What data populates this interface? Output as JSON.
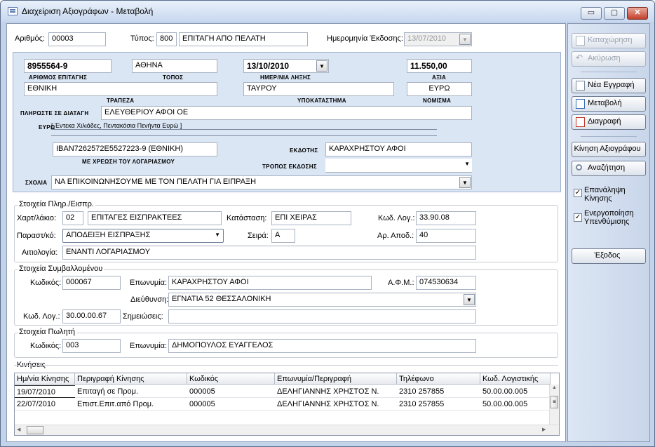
{
  "window": {
    "title": "Διαχείριση Αξιογράφων - Μεταβολή",
    "min": "▭",
    "max": "▢",
    "close": "✕"
  },
  "header": {
    "arithmos_label": "Αριθμός:",
    "arithmos": "00003",
    "typos_label": "Τύπος:",
    "typos_code": "800",
    "typos_desc": "ΕΠΙΤΑΓΗ ΑΠΟ ΠΕΛΑΤΗ",
    "hmer_label": "Ημερομηνία Έκδοσης:",
    "hmer_value": "13/07/2010"
  },
  "cheque": {
    "number": "8955564-9",
    "number_lbl": "ΑΡΙΘΜΟΣ ΕΠΙΤΑΓΗΣ",
    "place": "ΑΘΗΝΑ",
    "place_lbl": "ΤΟΠΟΣ",
    "due": "13/10/2010",
    "due_lbl": "ΗΜΕΡ/ΝΙΑ ΛΗΞΗΣ",
    "amount": "11.550,00",
    "amount_lbl": "ΑΞΙΑ",
    "bank": "ΕΘΝΙΚΗ",
    "bank_lbl": "ΤΡΑΠΕΖΑ",
    "branch": "ΤΑΥΡΟΥ",
    "branch_lbl": "ΥΠΟΚΑΤΑΣΤΗΜΑ",
    "currency": "ΕΥΡΩ",
    "currency_lbl": "ΝΟΜΙΣΜΑ",
    "payto_lbl": "ΠΛΗΡΩΣΤΕ ΣΕ ΔΙΑΤΑΓΗ",
    "payto": "ΕΛΕΥΘΕΡΙΟΥ ΑΦΟΙ ΟΕ",
    "euro_lbl": "ΕΥΡΩ",
    "amount_words": "[ Έντεκα Χιλιάδες, Πεντακόσια Πενήντα Ευρώ ]",
    "iban": "IBAN7262572E5527223-9 (ΕΘΝΙΚΗ)",
    "iban_lbl": "ΜΕ ΧΡΕΩΣΗ ΤΟΥ ΛΟΓΑΡΙΑΣΜΟΥ",
    "issuer_lbl": "ΕΚΔΟΤΗΣ",
    "issuer": "ΚΑΡΑΧΡΗΣΤΟΥ ΑΦΟΙ",
    "method_lbl": "ΤΡΟΠΟΣ ΕΚΔΟΣΗΣ",
    "method": "",
    "notes_lbl": "ΣΧΟΛΙΑ",
    "notes": "ΝΑ ΕΠΙΚΟΙΝΩΝΗΣΟΥΜΕ ΜΕ ΤΟΝ ΠΕΛΑΤΗ ΓΙΑ ΕΙΠΡΑΞΗ"
  },
  "payment": {
    "title": "Στοιχεία Πληρ./Εισπρ.",
    "xart_lbl": "Χαρτ/λάκιο:",
    "xart_code": "02",
    "xart_desc": "ΕΠΙΤΑΓΕΣ ΕΙΣΠΡΑΚΤΕΕΣ",
    "status_lbl": "Κατάσταση:",
    "status": "ΕΠΙ ΧΕΙΡΑΣ",
    "kodlog_lbl": "Κωδ. Λογ.:",
    "kodlog": "33.90.08",
    "parast_lbl": "Παραστ/κό:",
    "parast": "ΑΠΟΔΕΙΞΗ ΕΙΣΠΡΑΞΗΣ",
    "seira_lbl": "Σειρά:",
    "seira": "Α",
    "arapod_lbl": "Αρ. Αποδ.:",
    "arapod": "40",
    "aitiol_lbl": "Αιτιολογία:",
    "aitiol": "ΕΝΑΝΤΙ ΛΟΓΑΡΙΑΣΜΟΥ"
  },
  "party": {
    "title": "Στοιχεία Συμβαλλομένου",
    "kod_lbl": "Κωδικός:",
    "kod": "000067",
    "eponymia_lbl": "Επωνυμία:",
    "eponymia": "ΚΑΡΑΧΡΗΣΤΟΥ ΑΦΟΙ",
    "afm_lbl": "Α.Φ.Μ.:",
    "afm": "074530634",
    "addr_lbl": "Διεύθυνση:",
    "addr": "ΕΓΝΑΤΙΑ 52 ΘΕΣΣΑΛΟΝΙΚΗ",
    "kodlog_lbl": "Κωδ. Λογ.:",
    "kodlog": "30.00.00.67",
    "notes_lbl": "Σημειώσεις:",
    "notes": ""
  },
  "seller": {
    "title": "Στοιχεία Πωλητή",
    "kod_lbl": "Κωδικός:",
    "kod": "003",
    "eponymia_lbl": "Επωνυμία:",
    "eponymia": "ΔΗΜΟΠΟΥΛΟΣ ΕΥΑΓΓΕΛΟΣ"
  },
  "movements": {
    "title": "Κινήσεις",
    "columns": [
      "Ημ/νία Κίνησης",
      "Περιγραφή Κίνησης",
      "Κωδικός",
      "Επωνυμία/Περιγραφή",
      "Τηλέφωνο",
      "Κωδ. Λογιστικής"
    ],
    "rows": [
      [
        "19/07/2010",
        "Επιταγή σε Πρoμ.",
        "000005",
        "ΔΕΛΗΓΙΑΝΝΗΣ ΧΡΗΣΤΟΣ Ν.",
        "2310 257855",
        "50.00.00.005"
      ],
      [
        "22/07/2010",
        "Επιστ.Επιτ.από Προμ.",
        "000005",
        "ΔΕΛΗΓΙΑΝΝΗΣ ΧΡΗΣΤΟΣ Ν.",
        "2310 257855",
        "50.00.00.005"
      ]
    ]
  },
  "side": {
    "save": "Καταχώρηση",
    "cancel": "Ακύρωση",
    "new": "Νέα Εγγραφή",
    "edit": "Μεταβολή",
    "delete": "Διαγραφή",
    "movement": "Κίνηση Αξιογράφου",
    "search": "Αναζήτηση",
    "repeat": "Επανάληψη Κίνησης",
    "reminder": "Ενεργοποίηση Υπενθύμισης",
    "exit": "Έξοδος",
    "check_mark": "✓"
  },
  "glyphs": {
    "drop": "▼",
    "up": "▲",
    "left": "◀",
    "right": "▶",
    "grip": "≡"
  }
}
